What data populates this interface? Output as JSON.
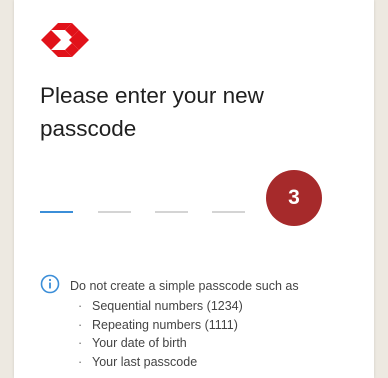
{
  "header": {
    "title": "Please enter your new passcode",
    "brand_color": "#e1121a"
  },
  "passcode": {
    "digits_total": 4,
    "digits_entered": 0,
    "active_slot_color": "#3b8ed8",
    "empty_slot_color": "#d4d4d4"
  },
  "step_badge": {
    "label": "3",
    "color": "#a62a2b"
  },
  "hint": {
    "icon": "info-icon",
    "title": "Do not create a simple passcode such as",
    "rules": [
      "Sequential numbers (1234)",
      "Repeating numbers (1111)",
      "Your date of birth",
      "Your last passcode"
    ]
  }
}
